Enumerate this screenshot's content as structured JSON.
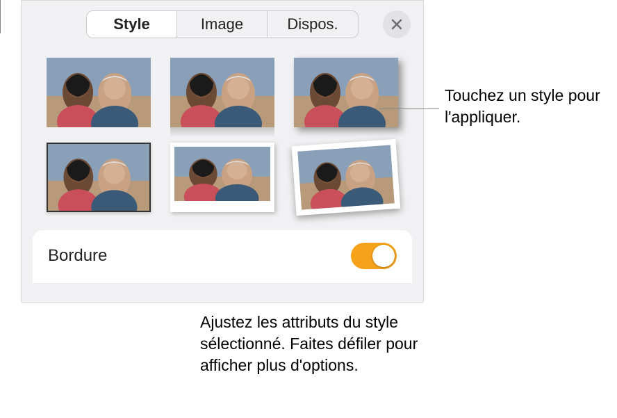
{
  "tabs": {
    "style": "Style",
    "image": "Image",
    "dispos": "Dispos."
  },
  "bordure": {
    "label": "Bordure",
    "on": true
  },
  "styles": [
    {
      "name": "plain"
    },
    {
      "name": "reflection"
    },
    {
      "name": "drop-shadow"
    },
    {
      "name": "border-thin"
    },
    {
      "name": "polaroid"
    },
    {
      "name": "matte-tilted"
    }
  ],
  "colors": {
    "accent": "#f6a21a"
  },
  "callouts": {
    "apply": "Touchez un style pour l'appliquer.",
    "adjust": "Ajustez les attributs du style sélectionné. Faites défiler pour afficher plus d'options."
  }
}
